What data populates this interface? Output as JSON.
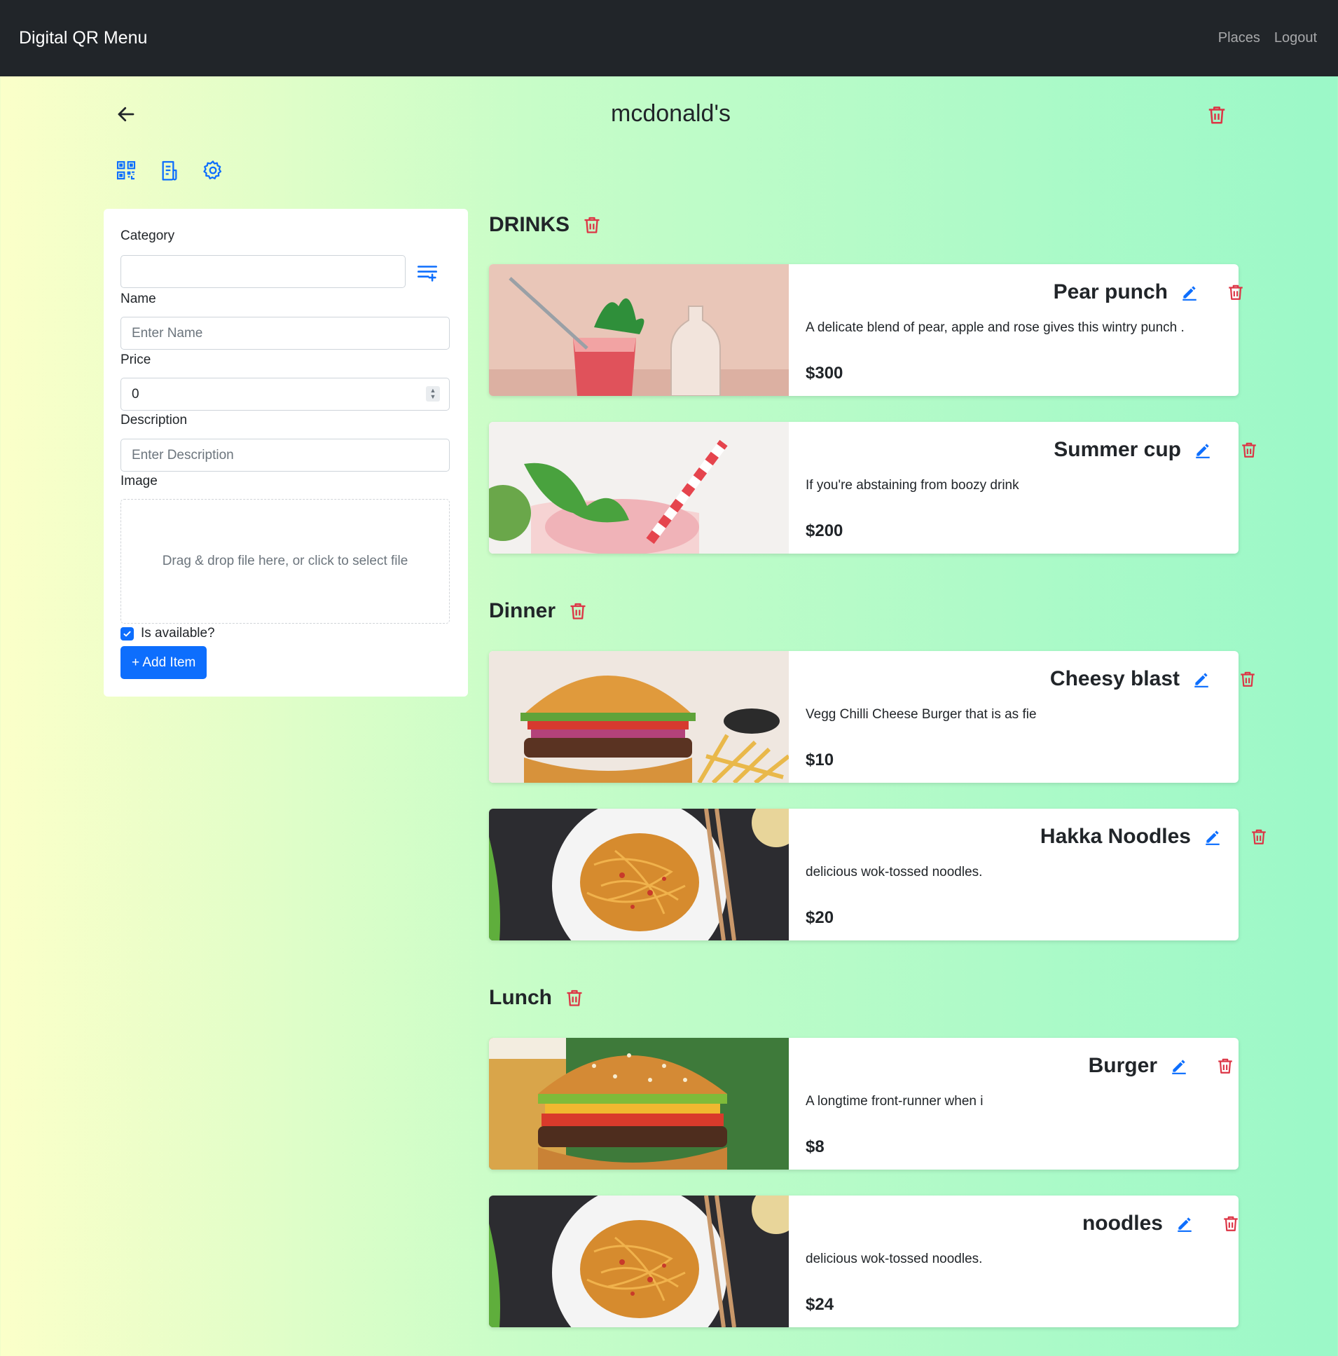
{
  "nav": {
    "brand": "Digital QR Menu",
    "links": [
      "Places",
      "Logout"
    ]
  },
  "place": {
    "title": "mcdonald's"
  },
  "toolbar": {
    "icons": [
      "qr-code-icon",
      "menu-receipt-icon",
      "gear-icon"
    ]
  },
  "form": {
    "category_label": "Category",
    "category_value": "",
    "name_label": "Name",
    "name_placeholder": "Enter Name",
    "price_label": "Price",
    "price_value": "0",
    "description_label": "Description",
    "description_placeholder": "Enter Description",
    "image_label": "Image",
    "dropzone_text": "Drag & drop file here, or click to select file",
    "available_label": "Is available?",
    "available_checked": true,
    "add_button": "+ Add Item"
  },
  "colors": {
    "accent": "#0d6efd",
    "danger": "#dc3545",
    "navbar": "#212529"
  },
  "categories": [
    {
      "title": "DRINKS",
      "items": [
        {
          "name": "Pear punch",
          "description": "A delicate blend of pear, apple and rose gives this wintry punch .",
          "price": "$300",
          "image": "pink-drink-glass-with-mint-and-straw"
        },
        {
          "name": "Summer cup",
          "description": "If you're abstaining from boozy drink",
          "price": "$200",
          "image": "iced-drink-with-mint-and-striped-straw"
        }
      ]
    },
    {
      "title": "Dinner",
      "items": [
        {
          "name": "Cheesy blast",
          "description": "Vegg Chilli Cheese Burger that is as fie",
          "price": "$10",
          "image": "burger-with-fries"
        },
        {
          "name": "Hakka Noodles",
          "description": "delicious wok-tossed noodles.",
          "price": "$20",
          "image": "plate-of-noodles-with-chopsticks"
        }
      ]
    },
    {
      "title": "Lunch",
      "items": [
        {
          "name": "Burger",
          "description": "A longtime front-runner when i",
          "price": "$8",
          "image": "sesame-burger-with-beer"
        },
        {
          "name": "noodles",
          "description": "delicious wok-tossed noodles.",
          "price": "$24",
          "image": "plate-of-noodles-with-chopsticks"
        }
      ]
    }
  ]
}
